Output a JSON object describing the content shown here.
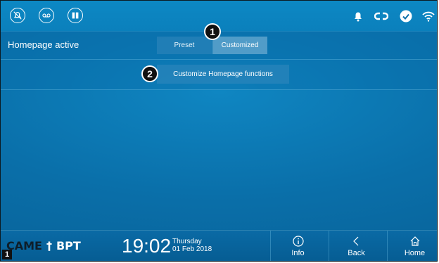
{
  "topbar": {
    "left_icons": [
      "muted-bell-icon",
      "voicemail-icon",
      "doors-icon"
    ],
    "right_icons": [
      "bell-icon",
      "link-icon",
      "check-circle-icon",
      "wifi-icon"
    ]
  },
  "homepage_row": {
    "label": "Homepage active",
    "options": [
      "Preset",
      "Customized"
    ],
    "selected": "Customized"
  },
  "customize_button": {
    "label": "Customize Homepage functions"
  },
  "callouts": [
    "1",
    "2"
  ],
  "bottombar": {
    "logo_left": "CAME",
    "logo_right": "BPT",
    "time": "19:02",
    "day": "Thursday",
    "date": "01 Feb 2018",
    "nav": [
      {
        "label": "Info",
        "icon": "info-icon"
      },
      {
        "label": "Back",
        "icon": "back-chevron-icon"
      },
      {
        "label": "Home",
        "icon": "home-icon"
      }
    ]
  },
  "page_badge": "1",
  "colors": {
    "background": "#0a6fa9",
    "text": "#ffffff",
    "callout": "#111111"
  }
}
